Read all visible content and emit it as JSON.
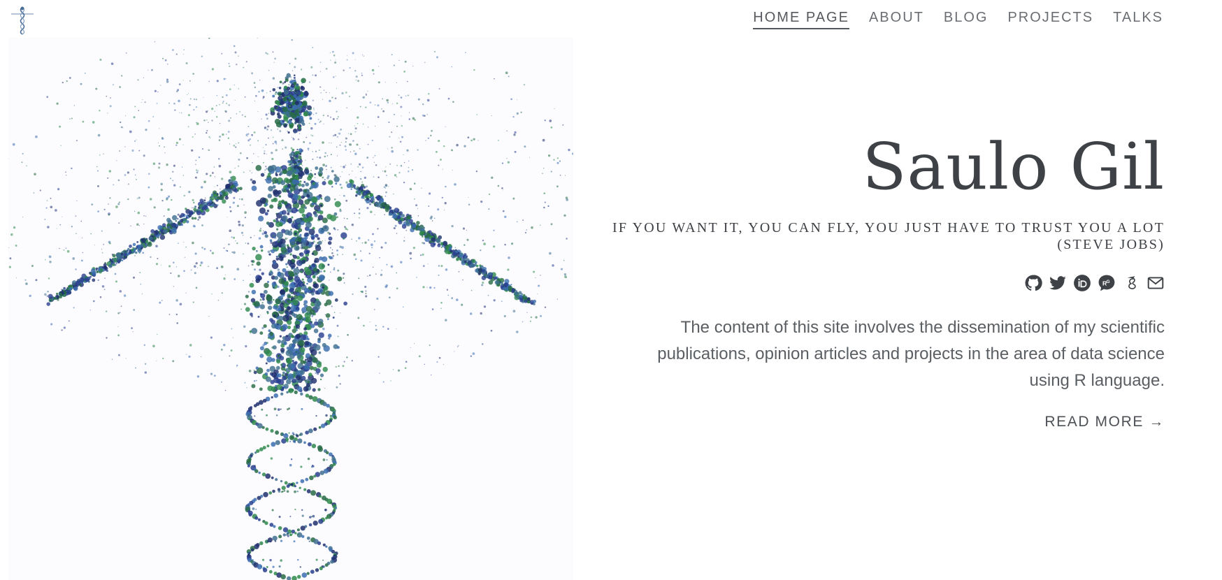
{
  "nav": {
    "items": [
      {
        "label": "HOME PAGE",
        "active": true
      },
      {
        "label": "ABOUT",
        "active": false
      },
      {
        "label": "BLOG",
        "active": false
      },
      {
        "label": "PROJECTS",
        "active": false
      },
      {
        "label": "TALKS",
        "active": false
      }
    ]
  },
  "hero": {
    "title": "Saulo Gil",
    "subtitle_line1": "IF YOU WANT IT, YOU CAN FLY, YOU JUST HAVE TO TRUST YOU A LOT",
    "subtitle_line2": "(STEVE JOBS)",
    "description_line1": "The content of this site involves the dissemination of my scientific",
    "description_line2": "publications, opinion articles and projects in the area of data science",
    "description_line3": "using R language.",
    "read_more_label": "READ MORE →"
  },
  "social_icons": [
    "github-icon",
    "twitter-icon",
    "orcid-icon",
    "researchgate-icon",
    "google-scholar-icon",
    "email-icon"
  ],
  "colors": {
    "text_dark": "#3e4145",
    "text_muted": "#5b5f63",
    "nav_text": "#6a6e73",
    "image_background": "#fcfcff",
    "dna_blue": "#2a3f8f",
    "dna_green": "#2f8a4e",
    "dna_teal": "#3f6f8f"
  }
}
